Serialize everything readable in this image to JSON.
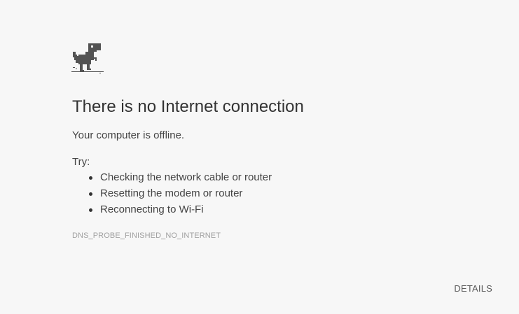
{
  "error": {
    "title": "There is no Internet connection",
    "subtitle": "Your computer is offline.",
    "try_label": "Try:",
    "suggestions": [
      "Checking the network cable or router",
      "Resetting the modem or router",
      "Reconnecting to Wi-Fi"
    ],
    "code": "DNS_PROBE_FINISHED_NO_INTERNET",
    "details_label": "DETAILS",
    "icon": "offline-dino-icon"
  },
  "colors": {
    "background": "#f7f7f7",
    "dino": "#535353",
    "text": "#333333",
    "muted": "#a0a0a0"
  }
}
